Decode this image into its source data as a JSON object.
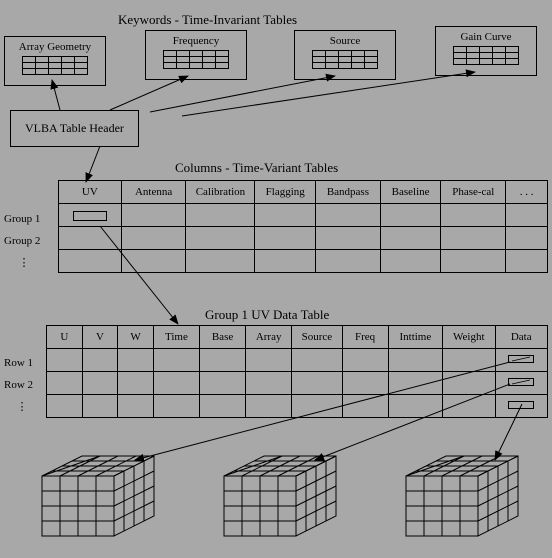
{
  "titles": {
    "keywords": "Keywords  -   Time-Invariant Tables",
    "columns": "Columns  -   Time-Variant Tables",
    "group1uv": "Group 1   UV Data Table"
  },
  "miniBoxes": {
    "arrayGeom": "Array  Geometry",
    "frequency": "Frequency",
    "source": "Source",
    "gainCurve": "Gain  Curve"
  },
  "headerBox": "VLBA  Table  Header",
  "colsTable": {
    "headers": [
      "UV",
      "Antenna",
      "Calibration",
      "Flagging",
      "Bandpass",
      "Baseline",
      "Phase-cal",
      ". . ."
    ],
    "rowLabels": [
      "Group  1",
      "Group  2",
      "⋮"
    ]
  },
  "uvTable": {
    "headers": [
      "U",
      "V",
      "W",
      "Time",
      "Base",
      "Array",
      "Source",
      "Freq",
      "Inttime",
      "Weight",
      "Data"
    ],
    "rowLabels": [
      "Row  1",
      "Row  2",
      "⋮"
    ]
  }
}
